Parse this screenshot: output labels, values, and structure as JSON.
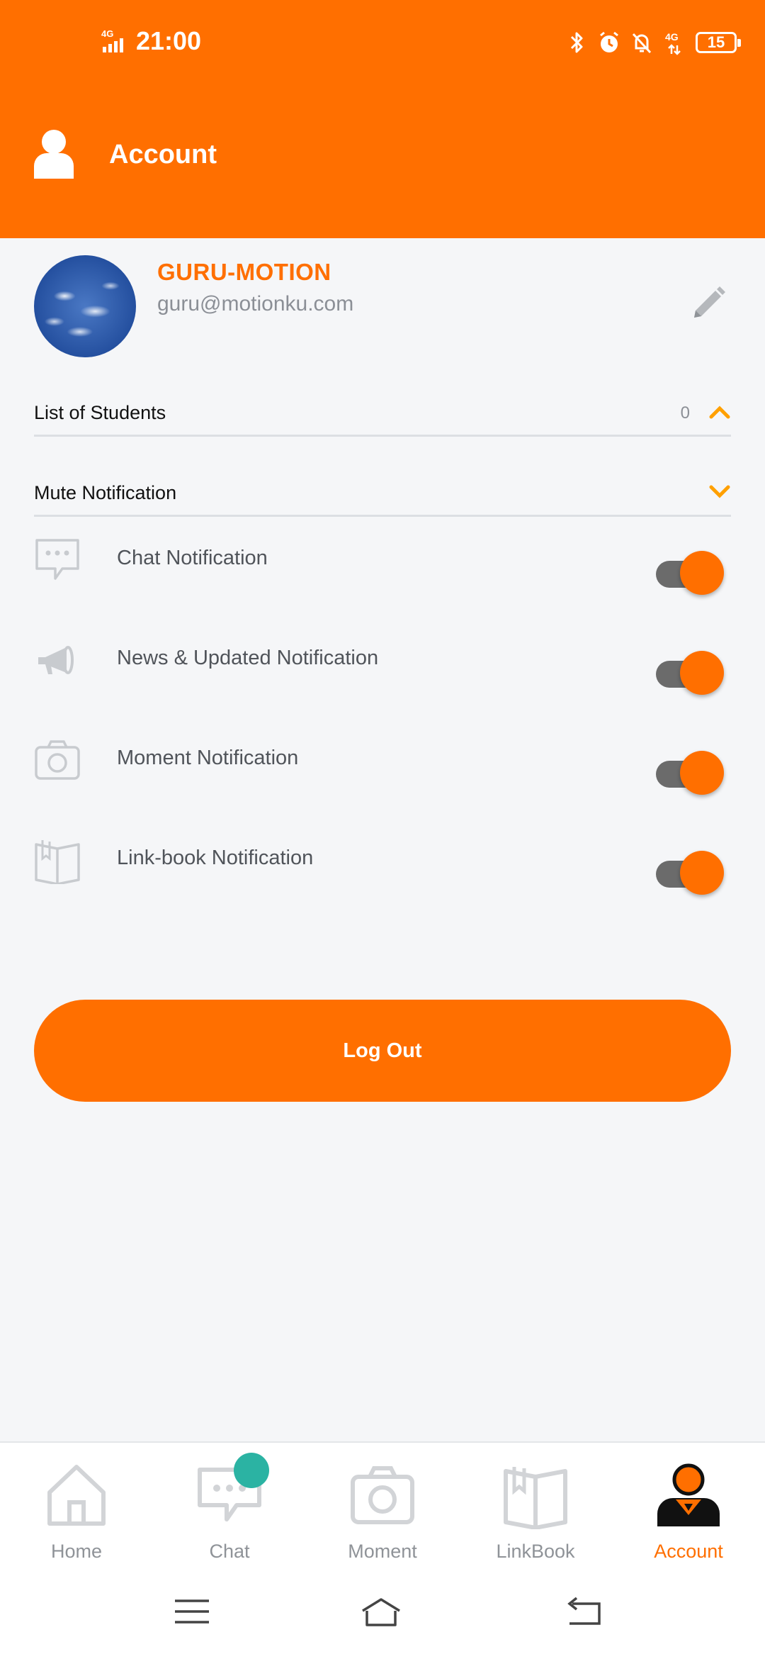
{
  "status_bar": {
    "network": "4G",
    "time": "21:00",
    "icons": [
      "bluetooth-icon",
      "alarm-icon",
      "notifications-off-icon",
      "4g-data-icon"
    ],
    "network_right": "4G",
    "battery": "15"
  },
  "header": {
    "title": "Account",
    "icon": "person-icon"
  },
  "profile": {
    "name": "GURU-MOTION",
    "email": "guru@motionku.com",
    "edit_icon": "pencil-icon"
  },
  "sections": {
    "students": {
      "label": "List of Students",
      "count": "0",
      "expanded": true
    },
    "mute": {
      "label": "Mute Notification",
      "expanded": false
    }
  },
  "notifications": [
    {
      "label": "Chat Notification",
      "icon": "chat-bubble-icon",
      "enabled": true
    },
    {
      "label": "News & Updated Notification",
      "icon": "megaphone-icon",
      "enabled": true
    },
    {
      "label": "Moment Notification",
      "icon": "camera-icon",
      "enabled": true
    },
    {
      "label": "Link-book Notification",
      "icon": "book-icon",
      "enabled": true
    }
  ],
  "logout_label": "Log Out",
  "bottom_nav": {
    "items": [
      {
        "label": "Home",
        "icon": "home-icon"
      },
      {
        "label": "Chat",
        "icon": "chat-icon"
      },
      {
        "label": "Moment",
        "icon": "camera-icon"
      },
      {
        "label": "LinkBook",
        "icon": "book-icon"
      },
      {
        "label": "Account",
        "icon": "account-icon"
      }
    ],
    "active": "Account"
  },
  "colors": {
    "accent": "#ff6f00",
    "badge": "#2bb3a3",
    "chevron": "#ffa000",
    "toggle_track": "#6b6b6b",
    "muted_text": "#8b8f96"
  }
}
